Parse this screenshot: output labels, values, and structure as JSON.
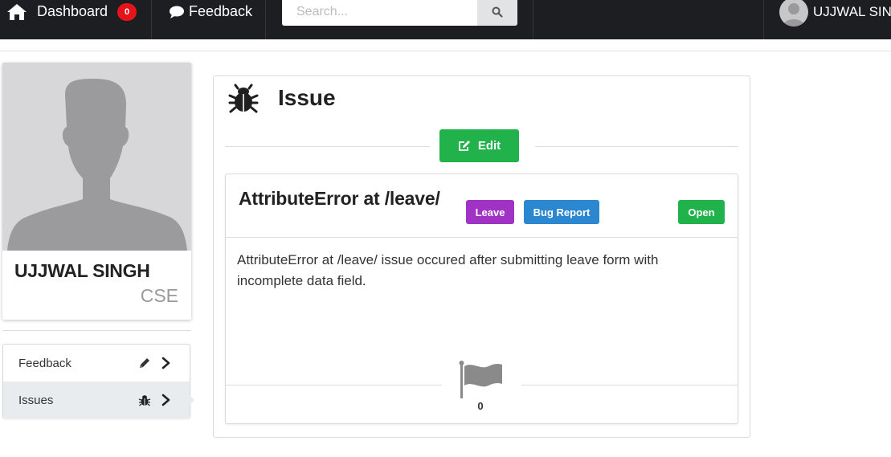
{
  "nav": {
    "dashboard_label": "Dashboard",
    "notification_count": "0",
    "feedback_label": "Feedback",
    "search_placeholder": "Search...",
    "user_name": "UJJWAL SIN"
  },
  "profile": {
    "name": "UJJWAL SINGH",
    "department": "CSE"
  },
  "sidebar": {
    "items": [
      {
        "label": "Feedback",
        "icon": "pencil-icon",
        "active": false
      },
      {
        "label": "Issues",
        "icon": "bug-icon",
        "active": true
      }
    ]
  },
  "issue": {
    "heading": "Issue",
    "edit_label": "Edit",
    "title": "AttributeError at /leave/",
    "tags": {
      "category": "Leave",
      "type": "Bug Report",
      "status": "Open"
    },
    "description": "AttributeError at /leave/ issue occured after submitting leave form with incomplete data field.",
    "flag_count": "0"
  },
  "colors": {
    "nav_bg": "#1c1e22",
    "badge_red": "#e5131a",
    "success_green": "#21b24b",
    "tag_purple": "#a033c4",
    "tag_blue": "#2b87d0"
  }
}
